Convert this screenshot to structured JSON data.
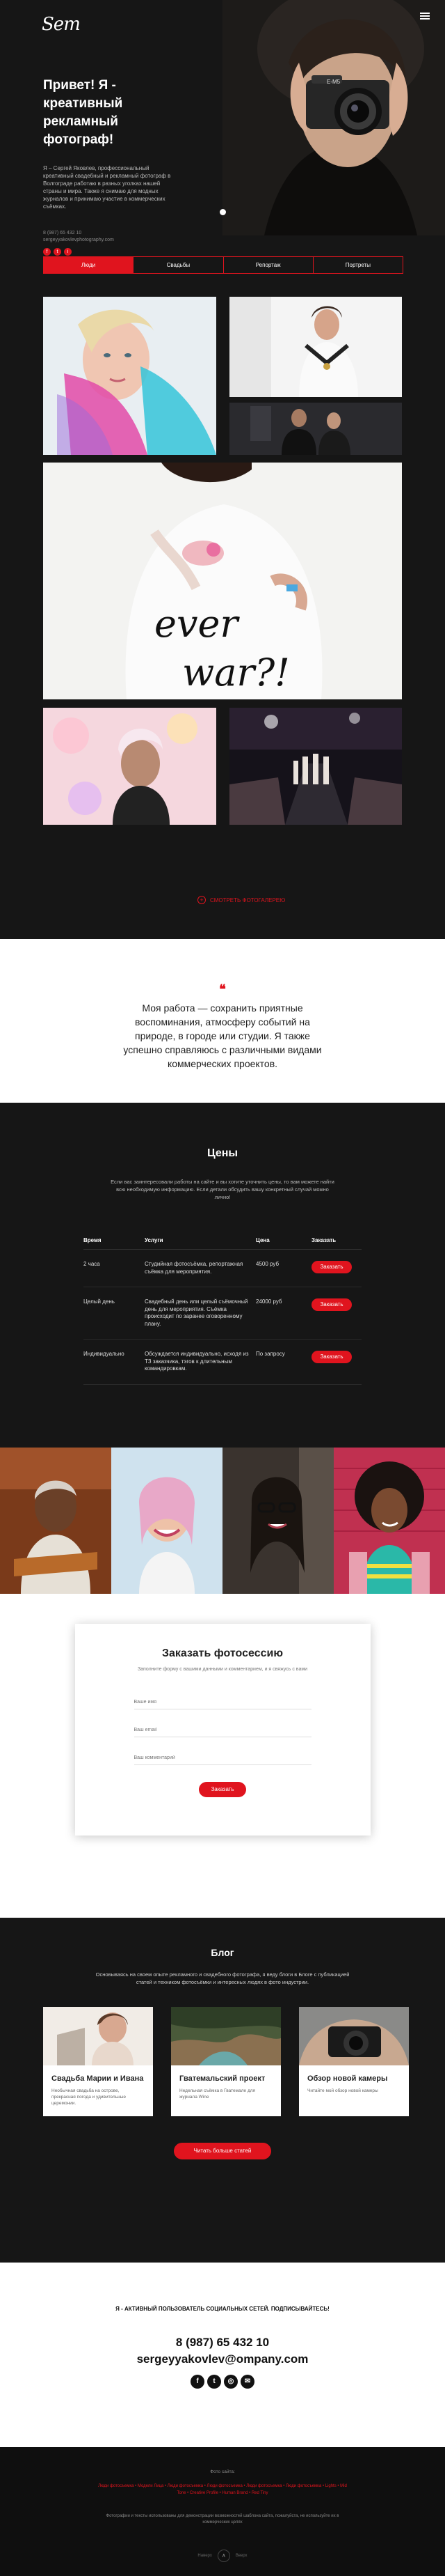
{
  "header": {
    "logo": "Sem",
    "title": "Привет! Я - креативный рекламный фотограф!",
    "description": "Я – Сергей Яковлев, профессиональный креативный свадебный и рекламный фотограф в Волгограде работаю в разных уголках нашей страны и мира. Также я снимаю для модных журналов и принимаю участие в коммерческих съёмках.",
    "phone": "8 (987) 65 432 10",
    "email": "sergeyyakovlevphotography.com",
    "social": [
      "f",
      "t",
      "i"
    ]
  },
  "tabs": [
    {
      "label": "Люди",
      "active": true
    },
    {
      "label": "Свадьбы",
      "active": false
    },
    {
      "label": "Репортаж",
      "active": false
    },
    {
      "label": "Портреты",
      "active": false
    }
  ],
  "gallery": {
    "link_label": "СМОТРЕТЬ ФОТОГАЛЕРЕЮ"
  },
  "quote": {
    "mark": "❝",
    "text": "Моя работа — сохранить приятные воспоминания, атмосферу событий на природе, в городе или студии. Я также успешно справляюсь с различными видами коммерческих проектов."
  },
  "prices": {
    "title": "Цены",
    "intro": "Если вас заинтересовали работы на сайте и вы хотите уточнить цены, то вам можете найти всю необходимую информацию. Если детали обсудить вашу конкретный случай можно лично!",
    "headers": [
      "Время",
      "Услуги",
      "Цена",
      "Заказать"
    ],
    "rows": [
      {
        "time": "2 часа",
        "service": "Студийная фотосъёмка, репортажная съёмка для мероприятия.",
        "price": "4500 руб",
        "button": "Заказать"
      },
      {
        "time": "Целый день",
        "service": "Свадебный день или целый съёмочный день для мероприятия. Съёмка происходит по заранее оговоренному плану.",
        "price": "24000 руб",
        "button": "Заказать"
      },
      {
        "time": "Индивидуально",
        "service": "Обсуждается индивидуально, исходя из ТЗ заказчика, тэгов к длительным командировкам.",
        "price": "По запросу",
        "button": "Заказать"
      }
    ]
  },
  "order": {
    "title": "Заказать фотосессию",
    "subtitle": "Заполните форму с вашими данными и комментарием, и я свяжусь с вами",
    "name_placeholder": "Ваше имя",
    "email_placeholder": "Ваш email",
    "comment_placeholder": "Ваш комментарий",
    "button": "Заказать"
  },
  "blog": {
    "title": "Блог",
    "intro": "Основываясь на своем опыте рекламного и свадебного фотографа, я веду блоги в Блоге с публикацией статей и техником фотосъёмки и интересных людях в фото индустрии.",
    "posts": [
      {
        "title": "Свадьба Марии и Ивана",
        "text": "Необычная свадьба на острове, прекрасная погода и удивительные церемонии."
      },
      {
        "title": "Гватемальский проект",
        "text": "Недельная съёмка в Гватемале для журнала Wine"
      },
      {
        "title": "Обзор новой камеры",
        "text": "Читайте мой обзор новой камеры"
      }
    ],
    "all_label": "Читать больше статей"
  },
  "contacts": {
    "follow": "Я - АКТИВНЫЙ ПОЛЬЗОВАТЕЛЬ СОЦИАЛЬНЫХ СЕТЕЙ. ПОДПИСЫВАЙТЕСЬ!",
    "phone": "8 (987) 65 432 10",
    "email": "sergeyyakovlev@ompany.com",
    "social": [
      "f",
      "t",
      "◎",
      "✉"
    ]
  },
  "footer": {
    "title": "Фото сайта:",
    "links": "Люди фотосъемка • Модели Лица • Люди фотосъемка • Люди фотосъемка • Люди фотосъемка • Люди фотосъемка • Lights • Mid Tone • Creative Profile • Human Brand • Red Tiny",
    "note": "Фотографии и тексты использованы для демонстрации возможностей шаблона сайта, пожалуйста, не используйте их в коммерческих целях",
    "up": "∧",
    "bottom_left": "Наверх",
    "bottom_right": "Вверх"
  },
  "colors": {
    "accent": "#e0141e",
    "dark": "#161616",
    "light": "#ffffff"
  }
}
